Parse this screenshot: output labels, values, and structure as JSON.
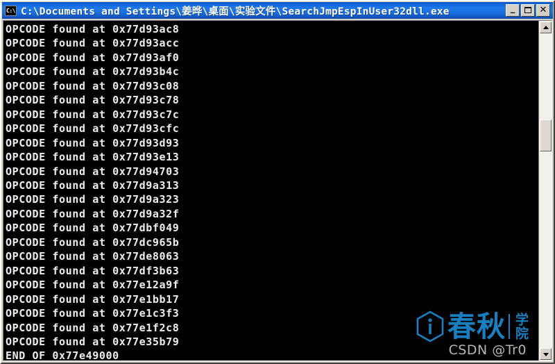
{
  "window": {
    "title": "C:\\Documents and Settings\\姜晔\\桌面\\实验文件\\SearchJmpEspInUser32dll.exe",
    "icon_label": "C:\\",
    "icon_name": "console-app-icon",
    "controls": {
      "minimize_label": "_",
      "maximize_label": "",
      "close_label": "✕"
    }
  },
  "console": {
    "background_color": "#000000",
    "text_color": "#e8e8e8",
    "lines": [
      "OPCODE found at 0x77d93ac8",
      "OPCODE found at 0x77d93acc",
      "OPCODE found at 0x77d93af0",
      "OPCODE found at 0x77d93b4c",
      "OPCODE found at 0x77d93c08",
      "OPCODE found at 0x77d93c78",
      "OPCODE found at 0x77d93c7c",
      "OPCODE found at 0x77d93cfc",
      "OPCODE found at 0x77d93d93",
      "OPCODE found at 0x77d93e13",
      "OPCODE found at 0x77d94703",
      "OPCODE found at 0x77d9a313",
      "OPCODE found at 0x77d9a323",
      "OPCODE found at 0x77d9a32f",
      "OPCODE found at 0x77dbf049",
      "OPCODE found at 0x77dc965b",
      "OPCODE found at 0x77de8063",
      "OPCODE found at 0x77df3b63",
      "OPCODE found at 0x77e12a9f",
      "OPCODE found at 0x77e1bb17",
      "OPCODE found at 0x77e1c3f3",
      "OPCODE found at 0x77e1f2c8",
      "OPCODE found at 0x77e35b79",
      "END OF 0x77e49000"
    ]
  },
  "scrollbar": {
    "up_arrow_name": "scroll-up-arrow-icon",
    "down_arrow_name": "scroll-down-arrow-icon"
  },
  "watermark": {
    "brand": "春秋",
    "sub": "学院",
    "credit": "CSDN @Tr0",
    "color": "#1a7fc1"
  }
}
